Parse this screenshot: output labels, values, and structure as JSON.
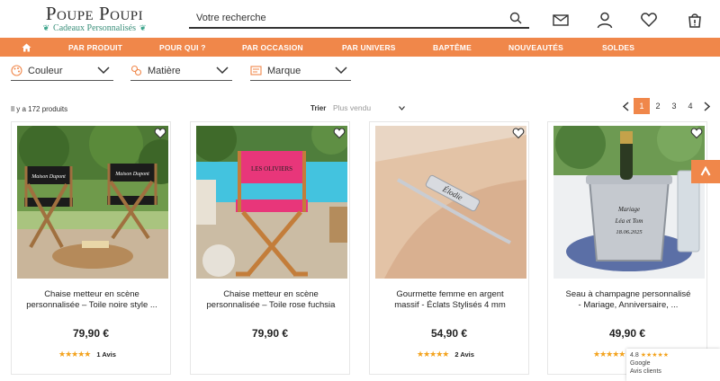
{
  "header": {
    "logo_name": "Poupe Poupi",
    "logo_sub": "Cadeaux Personnalisés",
    "search_placeholder": "Votre recherche",
    "icons": [
      "search-icon",
      "mail-icon",
      "user-icon",
      "heart-icon",
      "cart-icon"
    ]
  },
  "nav": {
    "home_icon": "home-icon",
    "items": [
      "PAR PRODUIT",
      "POUR QUI ?",
      "PAR OCCASION",
      "PAR UNIVERS",
      "BAPTÊME",
      "NOUVEAUTÉS",
      "SOLDES"
    ]
  },
  "filters": [
    {
      "label": "Couleur",
      "icon": "palette-icon"
    },
    {
      "label": "Matière",
      "icon": "material-icon"
    },
    {
      "label": "Marque",
      "icon": "brand-icon"
    }
  ],
  "listing": {
    "count_text": "Il y a 172 produits",
    "sort_label": "Trier",
    "sort_value": "Plus vendu"
  },
  "pagination": {
    "pages": [
      "1",
      "2",
      "3",
      "4"
    ],
    "active": "1"
  },
  "products": [
    {
      "title_line1": "Chaise metteur en scène",
      "title_line2": "personnalisée – Toile noire style ...",
      "price": "79,90 €",
      "rating_stars": 5,
      "reviews": "1 Avis",
      "chair_text": "Maison Dupont"
    },
    {
      "title_line1": "Chaise metteur en scène",
      "title_line2": "personnalisée – Toile rose fuchsia",
      "price": "79,90 €",
      "rating_stars": 5,
      "reviews": "",
      "chair_text": "LES OLIVIERS"
    },
    {
      "title_line1": "Gourmette femme en argent",
      "title_line2": "massif - Éclats Stylisés 4 mm",
      "price": "54,90 €",
      "rating_stars": 5,
      "reviews": "2 Avis",
      "bracelet_text": "Élodie"
    },
    {
      "title_line1": "Seau à champagne personnalisé",
      "title_line2": "- Mariage, Anniversaire, ...",
      "price": "49,90 €",
      "rating_stars": 5,
      "reviews": "",
      "bucket_text_1": "Mariage",
      "bucket_text_2": "Léa et Tom",
      "bucket_text_3": "18.06.2025"
    }
  ],
  "google_badge": {
    "rating": "4.8",
    "stars": "★★★★★",
    "brand": "Google",
    "label": "Avis clients"
  },
  "colors": {
    "accent": "#f0874a",
    "star": "#f3a21c",
    "fuchsia": "#e8367a"
  }
}
